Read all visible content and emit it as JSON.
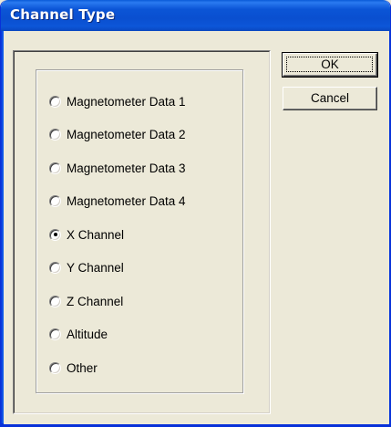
{
  "window": {
    "title": "Channel Type"
  },
  "buttons": {
    "ok_label": "OK",
    "cancel_label": "Cancel"
  },
  "channel_options": [
    {
      "label": "Magnetometer Data 1",
      "checked": false
    },
    {
      "label": "Magnetometer Data 2",
      "checked": false
    },
    {
      "label": "Magnetometer Data 3",
      "checked": false
    },
    {
      "label": "Magnetometer Data 4",
      "checked": false
    },
    {
      "label": "X Channel",
      "checked": true
    },
    {
      "label": "Y Channel",
      "checked": false
    },
    {
      "label": "Z Channel",
      "checked": false
    },
    {
      "label": "Altitude",
      "checked": false
    },
    {
      "label": "Other",
      "checked": false
    }
  ],
  "selected_option": "X Channel",
  "colors": {
    "titlebar": "#0a4fd0",
    "face": "#ece9d8"
  }
}
